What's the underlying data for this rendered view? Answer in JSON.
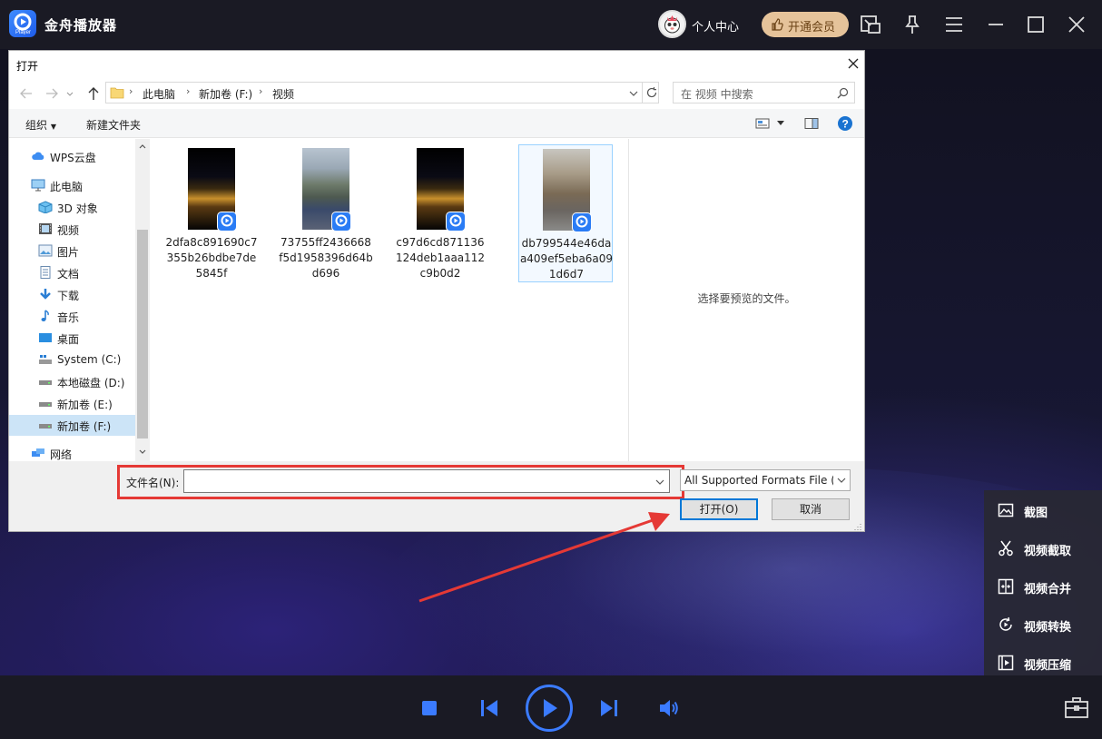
{
  "app": {
    "title": "金舟播放器",
    "user_center": "个人中心",
    "vip_button": "开通会员"
  },
  "tools": [
    "截图",
    "视频截取",
    "视频合并",
    "视频转换",
    "视频压缩"
  ],
  "dialog": {
    "title": "打开",
    "breadcrumb": [
      "此电脑",
      "新加卷 (F:)",
      "视频"
    ],
    "search_placeholder": "在 视频 中搜索",
    "organize": "组织",
    "new_folder": "新建文件夹",
    "nav_items": [
      {
        "label": "WPS云盘",
        "icon": "cloud-icon"
      },
      {
        "label": "此电脑",
        "icon": "computer-icon"
      },
      {
        "label": "3D 对象",
        "icon": "3d-objects-icon"
      },
      {
        "label": "视频",
        "icon": "video-folder-icon"
      },
      {
        "label": "图片",
        "icon": "pictures-icon"
      },
      {
        "label": "文档",
        "icon": "documents-icon"
      },
      {
        "label": "下载",
        "icon": "download-icon"
      },
      {
        "label": "音乐",
        "icon": "music-icon"
      },
      {
        "label": "桌面",
        "icon": "desktop-icon"
      },
      {
        "label": "System (C:)",
        "icon": "system-drive-icon"
      },
      {
        "label": "本地磁盘 (D:)",
        "icon": "drive-icon"
      },
      {
        "label": "新加卷 (E:)",
        "icon": "drive-icon"
      },
      {
        "label": "新加卷 (F:)",
        "icon": "drive-icon"
      },
      {
        "label": "网络",
        "icon": "network-icon"
      }
    ],
    "files": [
      {
        "name": "2dfa8c891690c7355b26bdbe7de5845f"
      },
      {
        "name": "73755ff2436668f5d1958396d64bd696"
      },
      {
        "name": "c97d6cd871136124deb1aaa112c9b0d2"
      },
      {
        "name": "db799544e46daa409ef5eba6a091d6d7"
      }
    ],
    "preview_text": "选择要预览的文件。",
    "filename_label": "文件名(N):",
    "filename_value": "",
    "filter": "All Supported Formats File (*",
    "open_button": "打开(O)",
    "cancel_button": "取消"
  },
  "colors": {
    "accent": "#2a7cf5",
    "highlight": "#e53935",
    "vip": "#e5c39a"
  }
}
